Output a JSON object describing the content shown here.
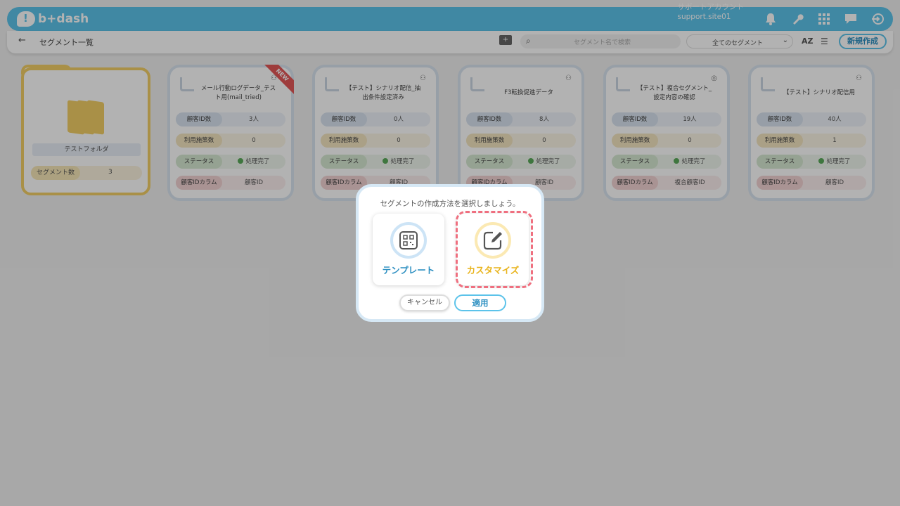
{
  "header": {
    "logo": "b+dash",
    "account_name": "サポートアカウント",
    "account_site": "support.site01",
    "icons": [
      "bell-icon",
      "wrench-icon",
      "grid-icon",
      "chat-icon",
      "logout-icon"
    ]
  },
  "subbar": {
    "back": "←",
    "title": "セグメント一覧",
    "search_placeholder": "セグメント名で検索",
    "filter_selected": "全てのセグメント",
    "sort_label": "AZ",
    "new_button": "新規作成"
  },
  "folder": {
    "name": "テストフォルダ",
    "count_label": "セグメント数",
    "count_value": "3"
  },
  "cards": [
    {
      "title": "メール行動ログデータ_テスト用(mail_tried)",
      "badge": "NEW",
      "customer_count": "3人",
      "measures": "0",
      "status": "処理完了",
      "id_column": "顧客ID"
    },
    {
      "title": "【テスト】シナリオ配信_抽出条件設定済み",
      "badge": "",
      "customer_count": "0人",
      "measures": "0",
      "status": "処理完了",
      "id_column": "顧客ID"
    },
    {
      "title": "F3転換促進データ",
      "badge": "",
      "customer_count": "8人",
      "measures": "0",
      "status": "処理完了",
      "id_column": "顧客ID"
    },
    {
      "title": "【テスト】複合セグメント_設定内容の確認",
      "badge": "",
      "customer_count": "19人",
      "measures": "0",
      "status": "処理完了",
      "id_column": "複合顧客ID"
    },
    {
      "title": "【テスト】シナリオ配信用",
      "badge": "",
      "customer_count": "40人",
      "measures": "1",
      "status": "処理完了",
      "id_column": "顧客ID"
    }
  ],
  "row_labels": {
    "customer_count": "顧客ID数",
    "measures": "利用施策数",
    "status": "ステータス",
    "id_column": "顧客IDカラム"
  },
  "modal": {
    "question": "セグメントの作成方法を選択しましょう。",
    "option_template": "テンプレート",
    "option_custom": "カスタマイズ",
    "cancel": "キャンセル",
    "apply": "適用"
  },
  "colors": {
    "brand": "#5cc3ea",
    "folder": "#f2cf66",
    "highlight": "#ef6f7f",
    "template_text": "#2c8fc1",
    "custom_text": "#e9b41d"
  }
}
